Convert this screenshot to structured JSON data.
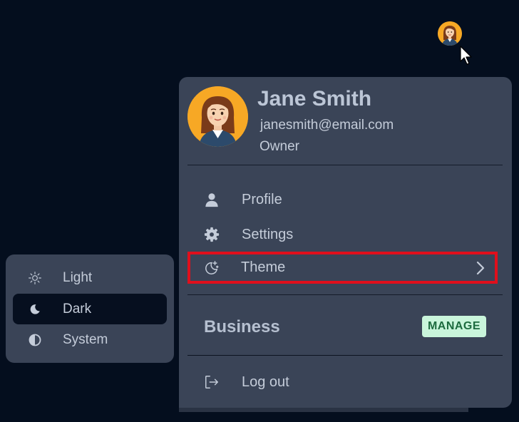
{
  "account_menu": {
    "name": "Jane Smith",
    "email": "janesmith@email.com",
    "role": "Owner",
    "items": [
      {
        "label": "Profile",
        "icon": "person-icon"
      },
      {
        "label": "Settings",
        "icon": "gear-icon"
      },
      {
        "label": "Theme",
        "icon": "moon-stars-icon"
      }
    ],
    "business": {
      "label": "Business",
      "action": "MANAGE"
    },
    "logout": {
      "label": "Log out",
      "icon": "logout-icon"
    }
  },
  "theme_submenu": {
    "selected": "Dark",
    "options": [
      {
        "label": "Light",
        "icon": "sun-icon"
      },
      {
        "label": "Dark",
        "icon": "moon-icon"
      },
      {
        "label": "System",
        "icon": "contrast-icon"
      }
    ]
  },
  "colors": {
    "background": "#040e1e",
    "panel": "#3a4457",
    "selected_option": "#060f1f",
    "highlight_outline": "#e00f1c",
    "manage_bg": "#c9f5db",
    "manage_text": "#1d6b3f",
    "avatar_bg": "#f7a825"
  }
}
